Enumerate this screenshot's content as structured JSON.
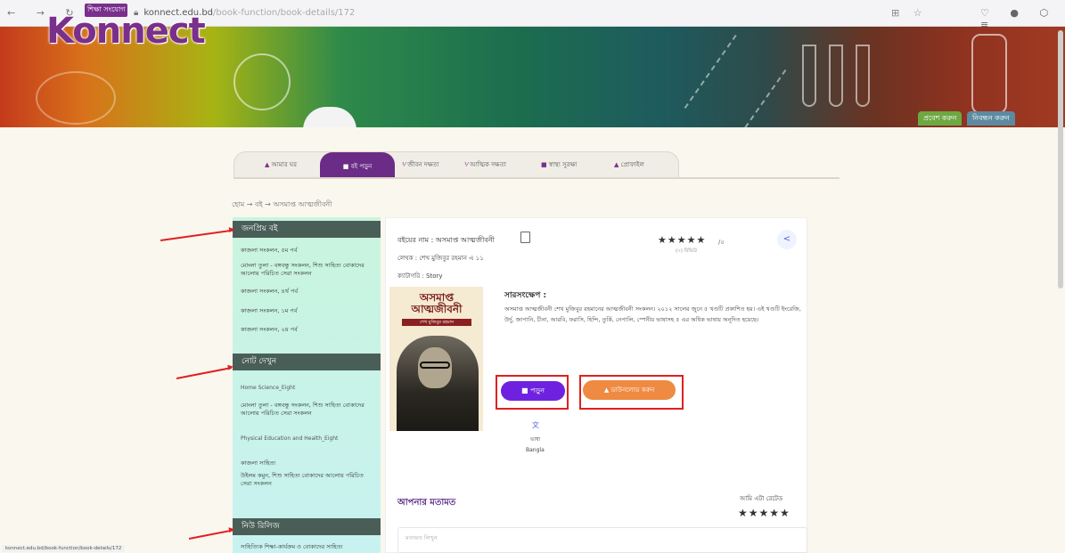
{
  "browser": {
    "nav_glyphs": "← → ↻",
    "url_host": "konnect.edu.bd",
    "url_path": "/book-function/book-details/172",
    "url_icons": "⊞ ☆",
    "right_icons": "♡ ● ⬡ ≡"
  },
  "banner": {
    "logo": "Konnect",
    "logo_tag": "শিক্ষা সংযোগ",
    "login_label": "প্রবেশ করুন",
    "register_label": "নিবন্ধন করুন"
  },
  "tabs": [
    {
      "label": "আমার ঘর",
      "icon": "home-icon"
    },
    {
      "label": "বই পড়ুন",
      "icon": "book-icon"
    },
    {
      "label": "জীবন দক্ষতা",
      "icon": "skills-icon"
    },
    {
      "label": "আত্মিক দক্ষতা",
      "icon": "soul-icon"
    },
    {
      "label": "স্বাস্থ্য সুরক্ষা",
      "icon": "health-icon"
    },
    {
      "label": "প্রোফাইল",
      "icon": "profile-icon"
    }
  ],
  "breadcrumb": "হোম → বই → অসমাপ্ত আত্মজীবনী",
  "sidebar": {
    "sections": [
      {
        "title": "জনপ্রিয় বই",
        "items": [
          "কাজলা সংকলন, ৫ম পর্ব",
          "মোংলা তুলা - বঙ্গবন্ধু সংকলন, শিশু সাহিত্য বোকাদের আলোয় পরিচিত সেরা সংকলন",
          "কাজলা সংকলন, ৪র্থ পর্ব",
          "কাজলা সংকলন, ১ম পর্ব",
          "কাজলা সংকলন, ২য় পর্ব"
        ]
      },
      {
        "title": "নোট দেখুন",
        "items": [
          "Home Science_Eight",
          "মোংলা তুলা - বঙ্গবন্ধু সংকলন, শিশু সাহিত্য বোকাদের আলোয় পরিচিত সেরা সংকলন",
          "Physical Education and Health_Eight",
          "কাজলা সাহিত্য",
          "উইলম কমুন, শিশু সাহিত্য বোকাদের আলোয় পরিচিত সেরা সংকলন"
        ]
      },
      {
        "title": "নিউ রিলিজ",
        "items": [
          "সাহিত্যিক শিক্ষা-কার্যক্রম ও বোকাদের সাহিত্য"
        ]
      }
    ]
  },
  "book": {
    "name": "বইয়ের নাম : অসমাপ্ত আত্মজীবনী",
    "author": "লেখক : শেখ মুজিবুর রহমান এ ১১",
    "category": "ক্যাটাগরি : Story",
    "rating_stars": "★★★★★",
    "rating_slash": "/৫",
    "rating_count": "(০) রিভিউ",
    "cover_title": "অসমাপ্ত আত্মজীবনী",
    "cover_author": "শেখ মুজিবুর রহমান",
    "summary_title": "সারসংক্ষেপ :",
    "summary": "অসমাপ্ত আত্মজীবনী শেখ মুজিবুর রহমানের আত্মজীবনী সংকলন। ২০১২ সালের জুনে ৫ খণ্ডটি প্রকাশিত হয়। এই খণ্ডটি ইংরেজি, উর্দু, জাপানি, চীনা, আরবি, ফরাসি, হিন্দি, তুর্কি, নেপালি, স্পেনীয় ভাষাসহ ৫ এর অধিক ভাষায় অনূদিত হয়েছে।",
    "read_label": "পড়ুন",
    "download_label": "ডাউনলোড করুন",
    "lang_a": "ভাষা",
    "lang_b": "Bangla"
  },
  "opinion": {
    "title": "আপনার মতামত",
    "rate_label": "আমি এটা রেটেড",
    "stars": "★★★★★",
    "placeholder": "মতামত লিখুন"
  },
  "status_url": "konnect.edu.bd/book-function/book-details/172"
}
